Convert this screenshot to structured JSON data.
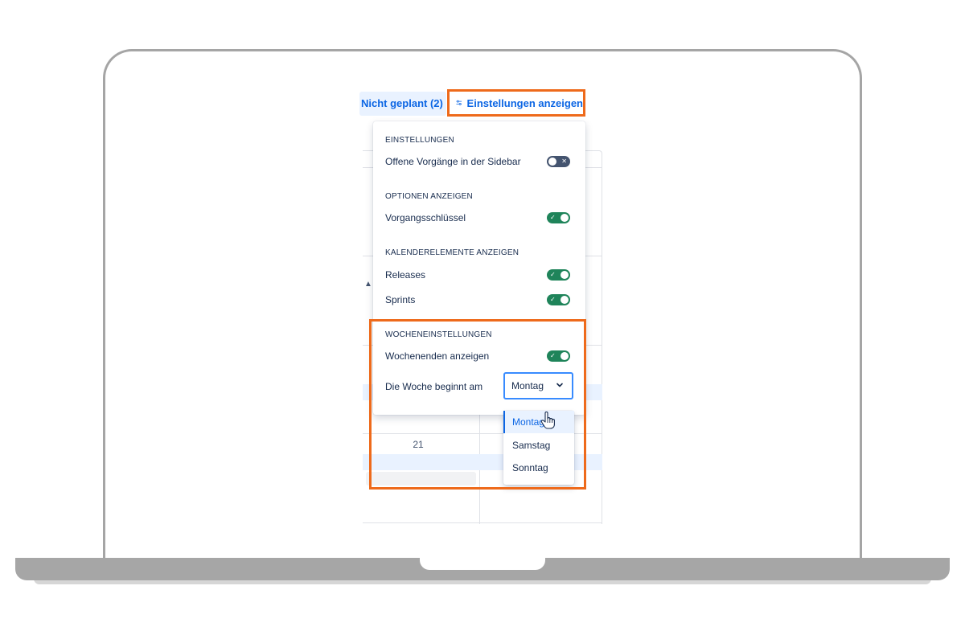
{
  "header": {
    "unplanned_tab": "Nicht geplant (2)",
    "settings_button": "Einstellungen anzeigen",
    "settings_icon": "sliders-icon"
  },
  "calendar": {
    "day_number": "21",
    "event_icon": "ship-icon"
  },
  "settings_panel": {
    "sections": [
      {
        "heading": "EINSTELLUNGEN",
        "rows": [
          {
            "label": "Offene Vorgänge in der Sidebar",
            "toggle": "off"
          }
        ]
      },
      {
        "heading": "OPTIONEN ANZEIGEN",
        "rows": [
          {
            "label": "Vorgangsschlüssel",
            "toggle": "on"
          }
        ]
      },
      {
        "heading": "KALENDERELEMENTE ANZEIGEN",
        "rows": [
          {
            "label": "Releases",
            "toggle": "on"
          },
          {
            "label": "Sprints",
            "toggle": "on"
          }
        ]
      },
      {
        "heading": "WOCHENEINSTELLUNGEN",
        "rows": [
          {
            "label": "Wochenenden anzeigen",
            "toggle": "on"
          },
          {
            "label": "Die Woche beginnt am",
            "select_value": "Montag"
          }
        ]
      }
    ]
  },
  "week_start_dropdown": {
    "options": [
      "Montag",
      "Samstag",
      "Sonntag"
    ],
    "selected": "Montag"
  },
  "colors": {
    "highlight": "#ee6a1b",
    "toggle_on": "#1f845a",
    "toggle_off": "#44546f",
    "link_blue": "#0c66e4"
  }
}
